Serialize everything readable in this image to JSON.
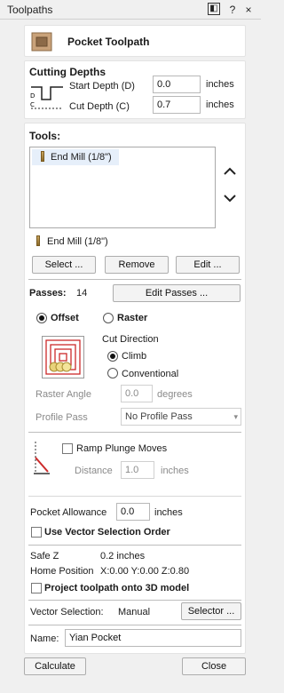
{
  "window": {
    "title": "Toolpaths",
    "help": "?",
    "close": "×"
  },
  "header": {
    "title": "Pocket Toolpath"
  },
  "cutting_depths": {
    "heading": "Cutting Depths",
    "start_label": "Start Depth (D)",
    "start_value": "0.0",
    "start_unit": "inches",
    "cut_label": "Cut Depth (C)",
    "cut_value": "0.7",
    "cut_unit": "inches"
  },
  "tools": {
    "heading": "Tools:",
    "list": [
      "End Mill (1/8\")"
    ],
    "selected_tool": "End Mill (1/8\")",
    "select_btn": "Select ...",
    "remove_btn": "Remove",
    "edit_btn": "Edit ..."
  },
  "passes": {
    "label": "Passes:",
    "count": "14",
    "edit_btn": "Edit Passes ..."
  },
  "strategy": {
    "offset": "Offset",
    "raster": "Raster",
    "cut_direction": "Cut Direction",
    "climb": "Climb",
    "conventional": "Conventional",
    "raster_angle_label": "Raster Angle",
    "raster_angle_value": "0.0",
    "raster_angle_unit": "degrees",
    "profile_pass_label": "Profile Pass",
    "profile_pass_value": "No Profile Pass"
  },
  "ramp": {
    "label": "Ramp Plunge Moves",
    "distance_label": "Distance",
    "distance_value": "1.0",
    "distance_unit": "inches"
  },
  "allowance": {
    "label": "Pocket Allowance",
    "value": "0.0",
    "unit": "inches",
    "vector_order": "Use Vector Selection Order"
  },
  "info": {
    "safe_z_label": "Safe Z",
    "safe_z_value": "0.2 inches",
    "home_label": "Home Position",
    "home_value": "X:0.00 Y:0.00 Z:0.80",
    "project": "Project toolpath onto 3D model"
  },
  "vector": {
    "label": "Vector Selection:",
    "mode": "Manual",
    "selector_btn": "Selector ..."
  },
  "name": {
    "label": "Name:",
    "value": "Yian Pocket"
  },
  "footer": {
    "calculate": "Calculate",
    "close": "Close"
  }
}
